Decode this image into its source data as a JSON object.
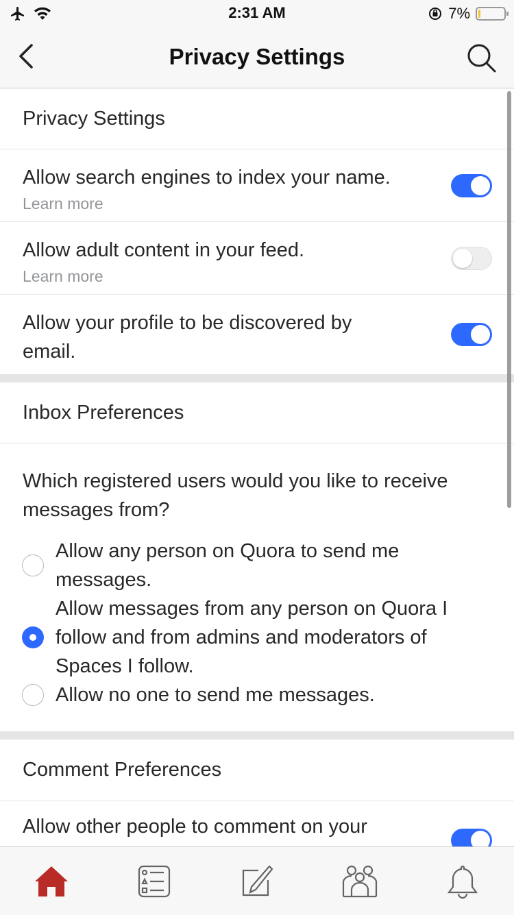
{
  "status_bar": {
    "time": "2:31 AM",
    "battery_percent": "7%",
    "battery_level": 0.07
  },
  "header": {
    "title": "Privacy Settings"
  },
  "privacy": {
    "title": "Privacy Settings",
    "items": [
      {
        "label": "Allow search engines to index your name.",
        "sub": "Learn more",
        "enabled": true
      },
      {
        "label": "Allow adult content in your feed.",
        "sub": "Learn more",
        "enabled": false
      },
      {
        "label": "Allow your profile to be discovered by email.",
        "enabled": true
      }
    ]
  },
  "inbox": {
    "title": "Inbox Preferences",
    "question": "Which registered users would you like to receive messages from?",
    "options": [
      {
        "label": "Allow any person on Quora to send me messages.",
        "selected": false
      },
      {
        "label": "Allow messages from any person on Quora I follow and from admins and moderators of Spaces I follow.",
        "selected": true
      },
      {
        "label": "Allow no one to send me messages.",
        "selected": false
      }
    ]
  },
  "comments": {
    "title": "Comment Preferences",
    "items": [
      {
        "label": "Allow other people to comment on your",
        "enabled": true
      }
    ]
  },
  "tabbar": {
    "tabs": [
      "home-icon",
      "following-icon",
      "write-icon",
      "spaces-icon",
      "notifications-icon"
    ],
    "active_color": "#b92b27",
    "inactive_color": "#636466"
  },
  "colors": {
    "accent": "#2e69ff",
    "brand": "#b92b27"
  }
}
